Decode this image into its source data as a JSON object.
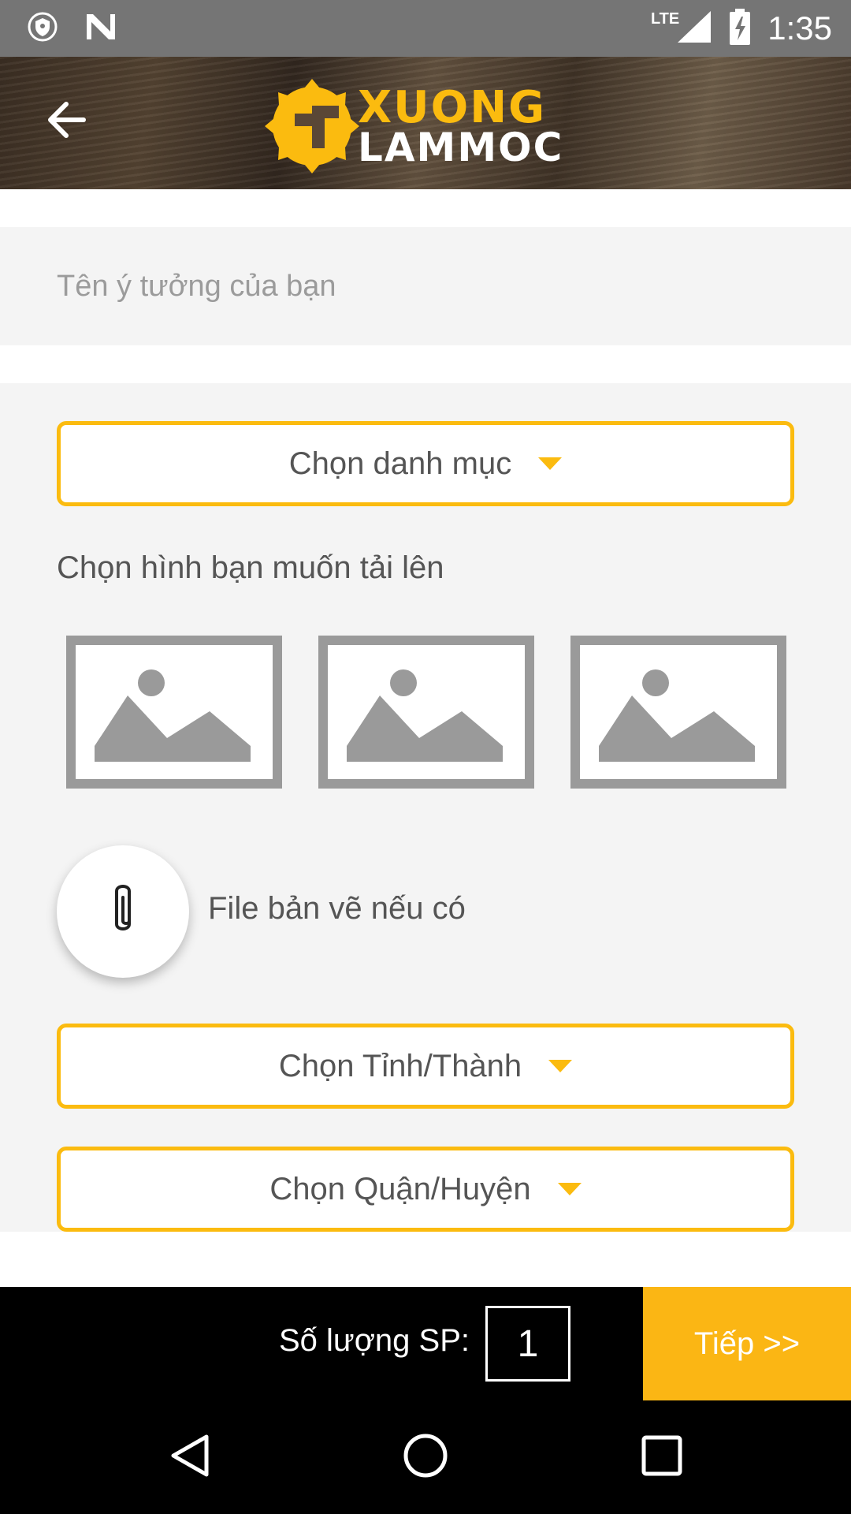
{
  "status_bar": {
    "time": "1:35",
    "network_label": "LTE",
    "icons": [
      "vpn-shield-icon",
      "n-notification-icon",
      "signal-icon",
      "battery-charging-icon"
    ]
  },
  "header": {
    "logo_line1": "XUONG",
    "logo_line2": "LAMMOC",
    "back_icon": "arrow-left-icon"
  },
  "form": {
    "idea_name_placeholder": "Tên ý tưởng của bạn",
    "category_dropdown": "Chọn danh mục",
    "images_label": "Chọn hình bạn muốn tải lên",
    "image_slots": [
      "image-placeholder-icon",
      "image-placeholder-icon",
      "image-placeholder-icon"
    ],
    "attach_label": "File bản vẽ nếu có",
    "province_dropdown": "Chọn Tỉnh/Thành",
    "district_dropdown": "Chọn Quận/Huyện"
  },
  "action_bar": {
    "quantity_label": "Số lượng SP:",
    "quantity_value": "1",
    "next_button": "Tiếp >>"
  },
  "colors": {
    "accent": "#fbbb0f",
    "next_button_bg": "#fbb614",
    "panel_bg": "#f4f4f4",
    "status_bar_bg": "#757575"
  },
  "nav_bar": {
    "icons": [
      "back-triangle-icon",
      "home-circle-icon",
      "recents-square-icon"
    ]
  }
}
